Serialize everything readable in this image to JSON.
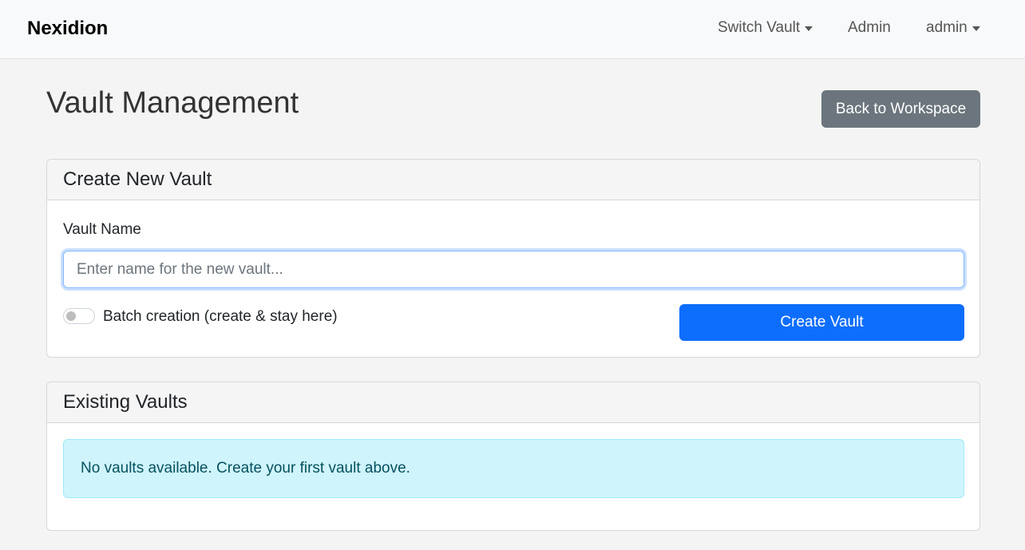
{
  "navbar": {
    "brand": "Nexidion",
    "switch_vault": "Switch Vault",
    "admin_link": "Admin",
    "user_menu": "admin"
  },
  "header": {
    "title": "Vault Management",
    "back_button": "Back to Workspace"
  },
  "create_card": {
    "title": "Create New Vault",
    "field_label": "Vault Name",
    "input_value": "",
    "input_placeholder": "Enter name for the new vault...",
    "batch_toggle_label": "Batch creation (create & stay here)",
    "batch_toggle_on": false,
    "submit_label": "Create Vault"
  },
  "existing_card": {
    "title": "Existing Vaults",
    "empty_message": "No vaults available. Create your first vault above."
  },
  "colors": {
    "primary": "#0d6efd",
    "secondary": "#6c757d",
    "info_bg": "#cff4fc",
    "info_text": "#055160"
  }
}
